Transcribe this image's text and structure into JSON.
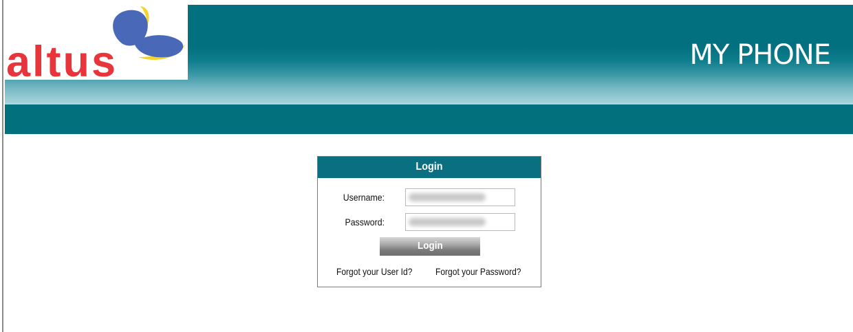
{
  "header": {
    "logo_text": "altus",
    "title": "MY PHONE"
  },
  "login": {
    "panel_title": "Login",
    "username_label": "Username:",
    "password_label": "Password:",
    "submit_label": "Login",
    "forgot_user_id": "Forgot your User Id?",
    "forgot_password": "Forgot your Password?"
  },
  "colors": {
    "header_teal": "#02707f",
    "panel_header": "#0a6f80",
    "logo_red": "#e8343b",
    "logo_blue": "#4a68b8",
    "logo_yellow": "#f5d327"
  }
}
